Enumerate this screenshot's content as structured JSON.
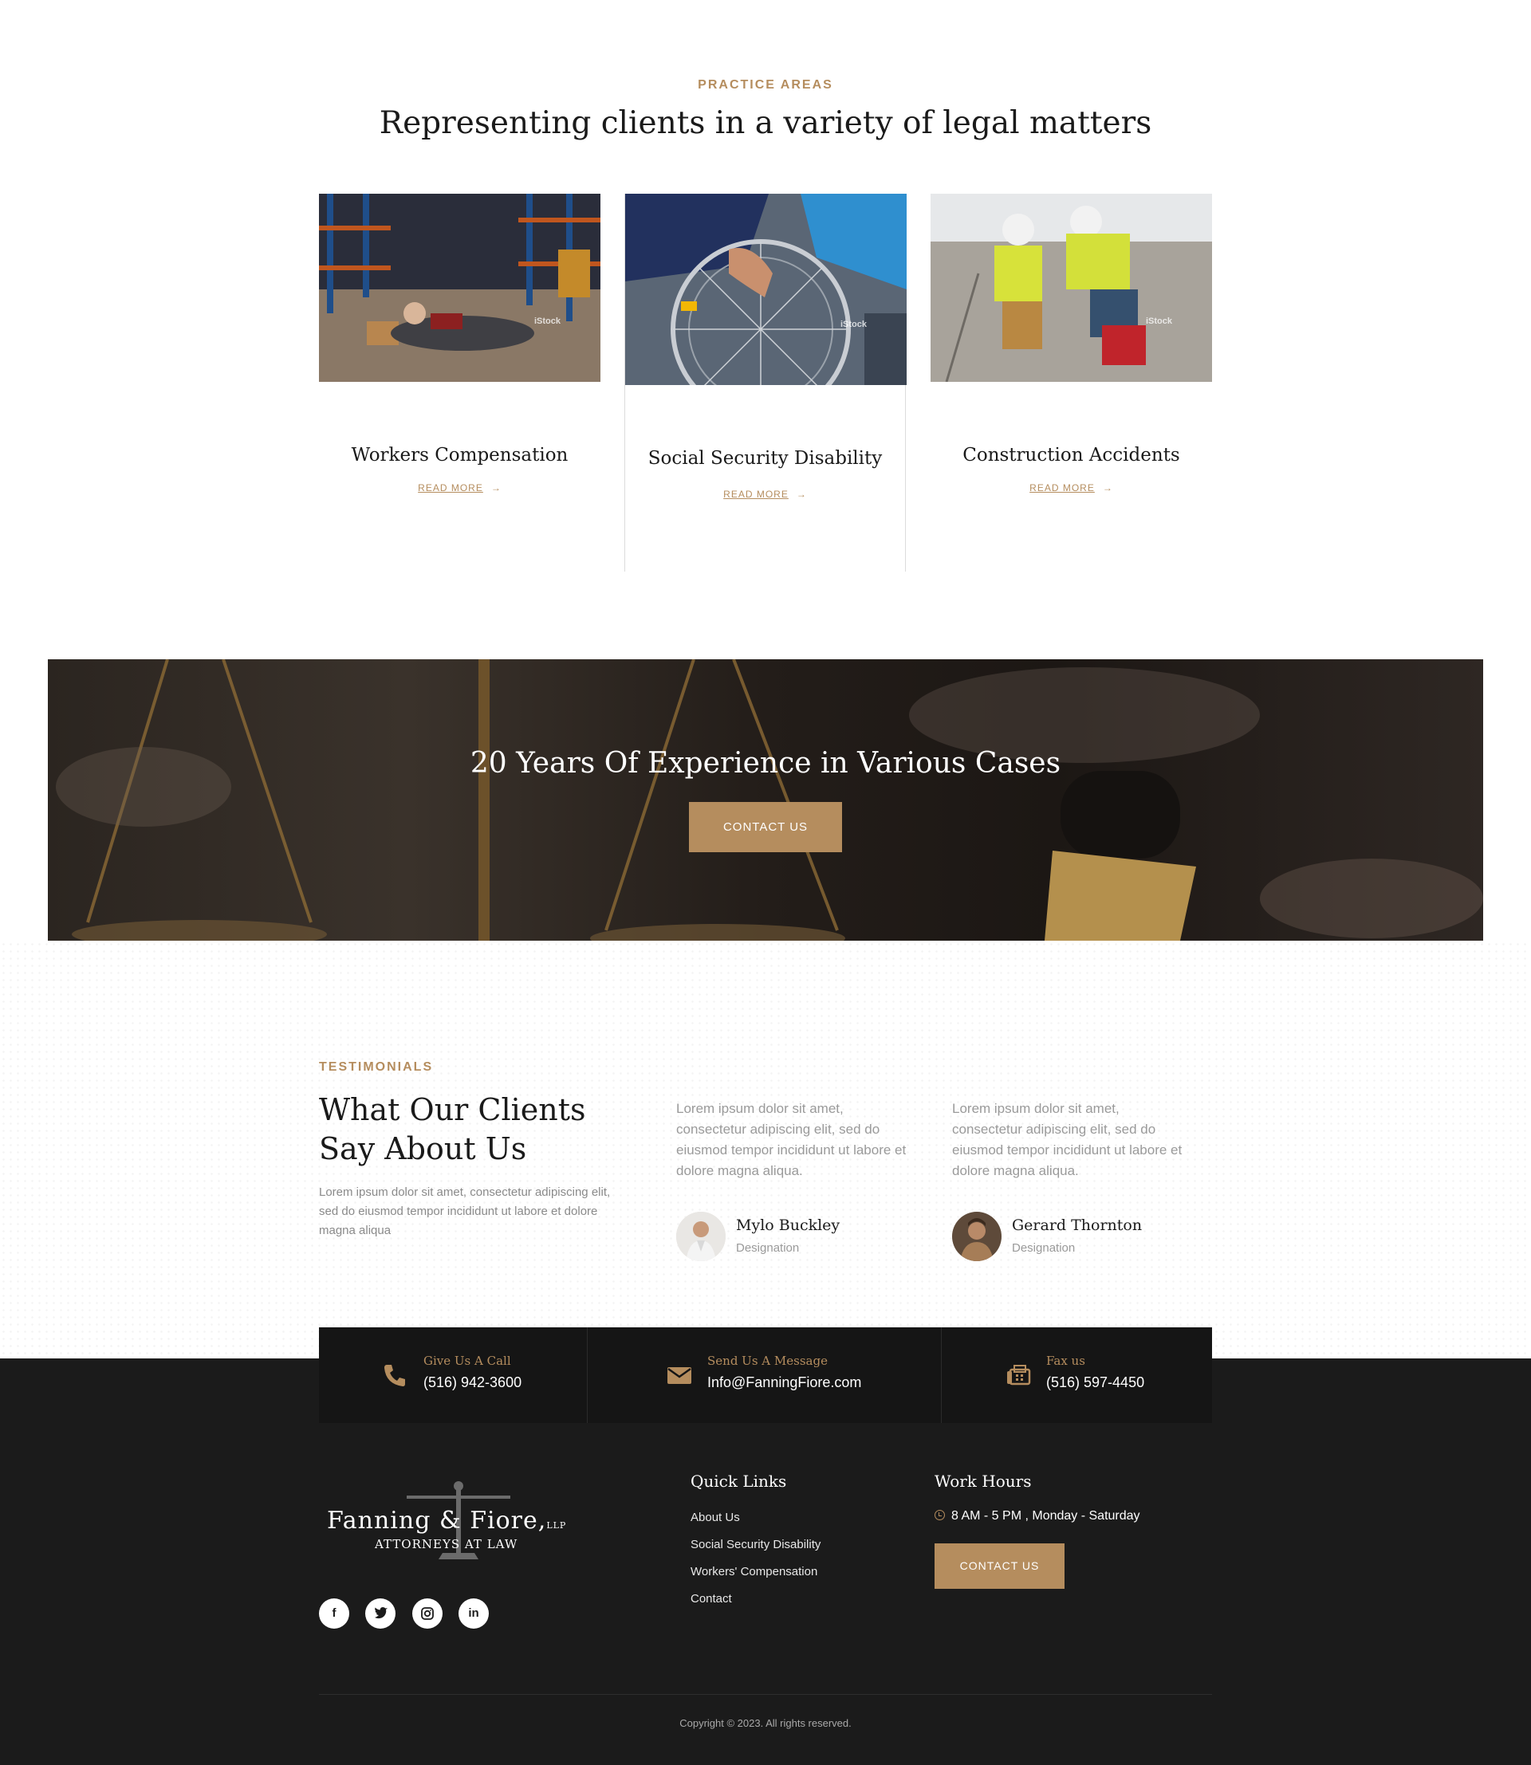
{
  "practice": {
    "eyebrow": "PRACTICE AREAS",
    "title": "Representing clients in a variety of legal matters",
    "cards": [
      {
        "title": "Workers Compensation",
        "link": "READ MORE",
        "watermark": "iStock"
      },
      {
        "title": "Social Security Disability",
        "link": "READ MORE",
        "watermark": "iStock"
      },
      {
        "title": "Construction Accidents",
        "link": "READ MORE",
        "watermark": "iStock"
      }
    ]
  },
  "banner": {
    "title": "20 Years Of Experience in Various Cases",
    "button": "CONTACT US"
  },
  "testimonials": {
    "eyebrow": "TESTIMONIALS",
    "title": "What Our Clients Say About Us",
    "description": "Lorem ipsum dolor sit amet, consectetur adipiscing elit, sed do eiusmod tempor incididunt ut labore et dolore magna aliqua",
    "items": [
      {
        "quote": "Lorem ipsum dolor sit amet, consectetur adipiscing elit, sed do eiusmod tempor incididunt ut labore et dolore magna aliqua.",
        "name": "Mylo Buckley",
        "role": "Designation"
      },
      {
        "quote": "Lorem ipsum dolor sit amet, consectetur adipiscing elit, sed do eiusmod tempor incididunt ut labore et dolore magna aliqua.",
        "name": "Gerard Thornton",
        "role": "Designation"
      }
    ]
  },
  "contact_bar": {
    "call": {
      "label": "Give Us A Call",
      "value": "(516) 942-3600",
      "icon": "phone-icon"
    },
    "message": {
      "label": "Send Us A Message",
      "value": "Info@FanningFiore.com",
      "icon": "envelope-icon"
    },
    "fax": {
      "label": "Fax us",
      "value": "(516) 597-4450",
      "icon": "fax-icon"
    }
  },
  "footer": {
    "logo": {
      "line1": "Fanning & Fiore,",
      "suffix": "LLP",
      "line2": "ATTORNEYS AT LAW"
    },
    "social": [
      "f",
      "t",
      "ig",
      "in"
    ],
    "quick_links": {
      "heading": "Quick Links",
      "items": [
        "About Us",
        "Social Security Disability",
        "Workers' Compensation",
        "Contact"
      ]
    },
    "work_hours": {
      "heading": "Work Hours",
      "hours": "8 AM - 5 PM , Monday - Saturday",
      "button": "CONTACT US"
    },
    "copyright": "Copyright © 2023. All rights reserved."
  },
  "colors": {
    "accent": "#b58d5e",
    "footer_bg": "#1b1b1b",
    "contact_bar_bg": "#151515"
  }
}
